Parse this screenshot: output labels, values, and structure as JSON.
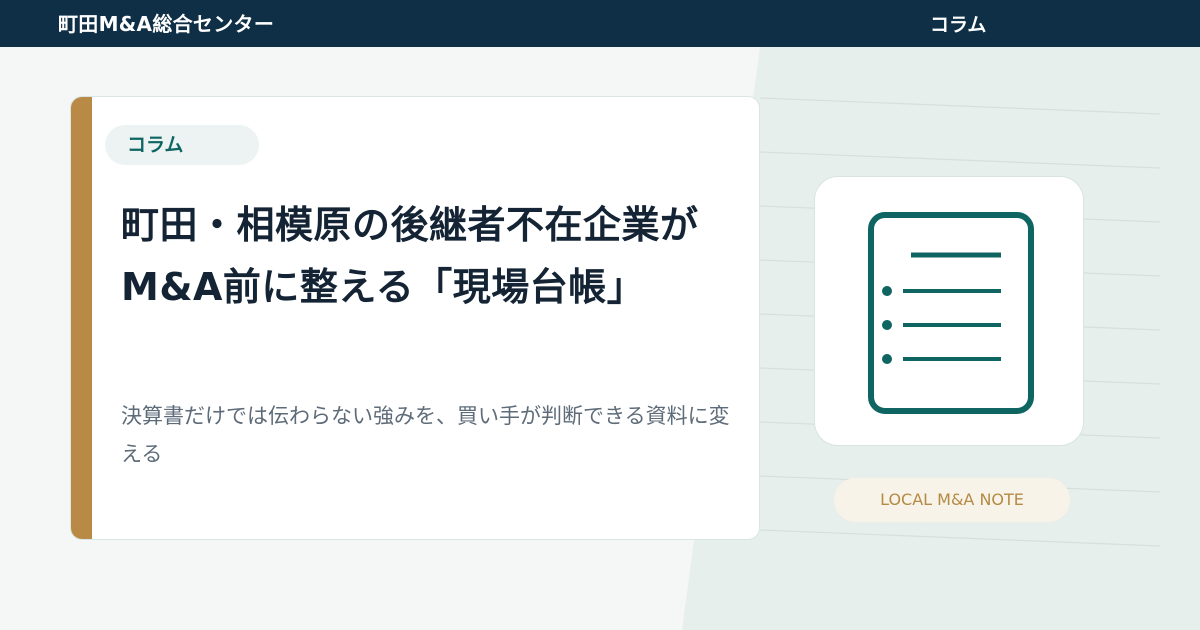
{
  "header": {
    "brand": "町田M&A総合センター",
    "category": "コラム"
  },
  "card": {
    "tag": "コラム",
    "title": "町田・相模原の後継者不在企業がM&A前に整える「現場台帳」",
    "subtitle": "決算書だけでは伝わらない強みを、買い手が判断できる資料に変える"
  },
  "illustration": {
    "icon": "document-list-icon",
    "badge": "LOCAL M&A NOTE"
  },
  "colors": {
    "navy": "#0f2f47",
    "teal": "#0e6561",
    "gold": "#b88a45",
    "title": "#142434",
    "subtitle": "#5e6b78"
  }
}
